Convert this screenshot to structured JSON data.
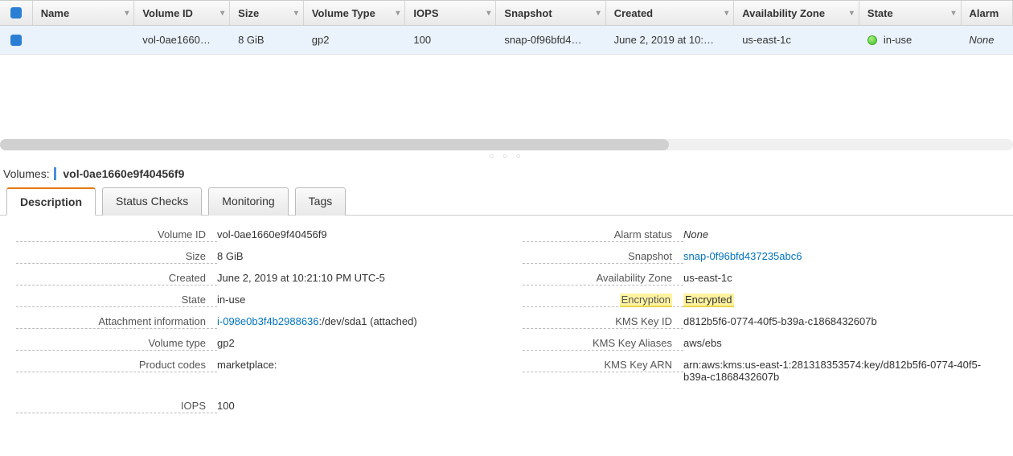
{
  "columns": {
    "name": "Name",
    "volume_id": "Volume ID",
    "size": "Size",
    "volume_type": "Volume Type",
    "iops": "IOPS",
    "snapshot": "Snapshot",
    "created": "Created",
    "az": "Availability Zone",
    "state": "State",
    "alarm": "Alarm"
  },
  "row": {
    "name": "",
    "volume_id": "vol-0ae1660…",
    "size": "8 GiB",
    "volume_type": "gp2",
    "iops": "100",
    "snapshot": "snap-0f96bfd4…",
    "created": "June 2, 2019 at 10:…",
    "az": "us-east-1c",
    "state": "in-use",
    "alarm": "None"
  },
  "divider_dots": "○ ○ ○",
  "detail_header": {
    "prefix": "Volumes:",
    "id": "vol-0ae1660e9f40456f9"
  },
  "tabs": {
    "description": "Description",
    "status_checks": "Status Checks",
    "monitoring": "Monitoring",
    "tags": "Tags"
  },
  "details_left": {
    "volume_id": {
      "label": "Volume ID",
      "value": "vol-0ae1660e9f40456f9"
    },
    "size": {
      "label": "Size",
      "value": "8 GiB"
    },
    "created": {
      "label": "Created",
      "value": "June 2, 2019 at 10:21:10 PM UTC-5"
    },
    "state": {
      "label": "State",
      "value": "in-use"
    },
    "attachment": {
      "label": "Attachment information",
      "link": "i-098e0b3f4b2988636",
      "suffix": ":/dev/sda1 (attached)"
    },
    "volume_type": {
      "label": "Volume type",
      "value": "gp2"
    },
    "product_codes": {
      "label": "Product codes",
      "value": "marketplace:"
    },
    "iops": {
      "label": "IOPS",
      "value": "100"
    }
  },
  "details_right": {
    "alarm_status": {
      "label": "Alarm status",
      "value": "None"
    },
    "snapshot": {
      "label": "Snapshot",
      "link": "snap-0f96bfd437235abc6"
    },
    "az": {
      "label": "Availability Zone",
      "value": "us-east-1c"
    },
    "encryption": {
      "label": "Encryption",
      "value": "Encrypted"
    },
    "kms_key_id": {
      "label": "KMS Key ID",
      "value": "d812b5f6-0774-40f5-b39a-c1868432607b"
    },
    "kms_key_aliases": {
      "label": "KMS Key Aliases",
      "value": "aws/ebs"
    },
    "kms_key_arn": {
      "label": "KMS Key ARN",
      "value": "arn:aws:kms:us-east-1:281318353574:key/d812b5f6-0774-40f5-b39a-c1868432607b"
    }
  }
}
